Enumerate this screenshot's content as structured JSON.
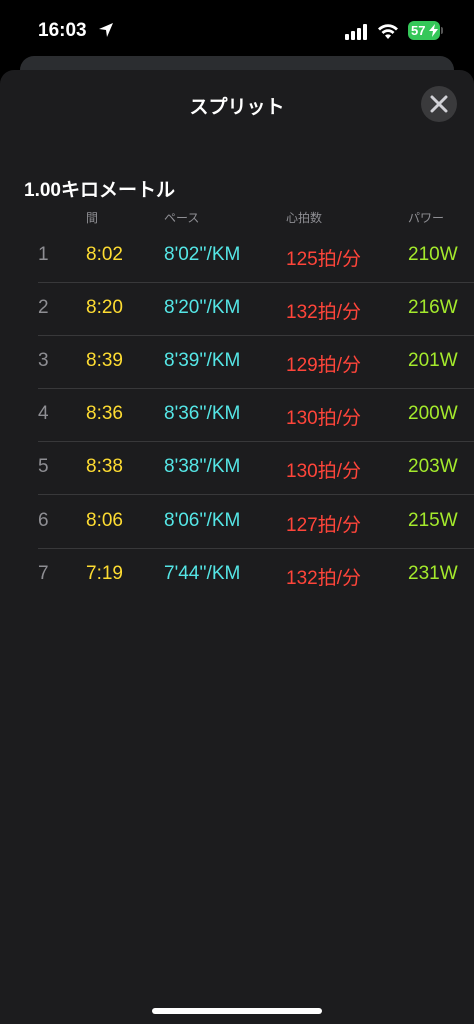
{
  "status_bar": {
    "time": "16:03",
    "battery": "57",
    "icons": [
      "location-arrow-icon",
      "signal-icon",
      "wifi-icon",
      "battery-icon"
    ]
  },
  "sheet": {
    "title": "スプリット",
    "close_icon": "close-icon"
  },
  "splits": {
    "section_title": "1.00キロメートル",
    "headers": {
      "time": "間",
      "pace": "ペース",
      "heart_rate": "心拍数",
      "power": "パワー"
    },
    "rows": [
      {
        "num": "1",
        "time": "8:02",
        "pace": "8'02''/KM",
        "heart_rate": "125拍/分",
        "power": "210W"
      },
      {
        "num": "2",
        "time": "8:20",
        "pace": "8'20''/KM",
        "heart_rate": "132拍/分",
        "power": "216W"
      },
      {
        "num": "3",
        "time": "8:39",
        "pace": "8'39''/KM",
        "heart_rate": "129拍/分",
        "power": "201W"
      },
      {
        "num": "4",
        "time": "8:36",
        "pace": "8'36''/KM",
        "heart_rate": "130拍/分",
        "power": "200W"
      },
      {
        "num": "5",
        "time": "8:38",
        "pace": "8'38''/KM",
        "heart_rate": "130拍/分",
        "power": "203W"
      },
      {
        "num": "6",
        "time": "8:06",
        "pace": "8'06''/KM",
        "heart_rate": "127拍/分",
        "power": "215W"
      },
      {
        "num": "7",
        "time": "7:19",
        "pace": "7'44''/KM",
        "heart_rate": "132拍/分",
        "power": "231W"
      }
    ]
  },
  "colors": {
    "time": "#fedc32",
    "pace": "#55e6e6",
    "heart_rate": "#ff453a",
    "power": "#a4ea2c",
    "battery": "#35c759"
  }
}
